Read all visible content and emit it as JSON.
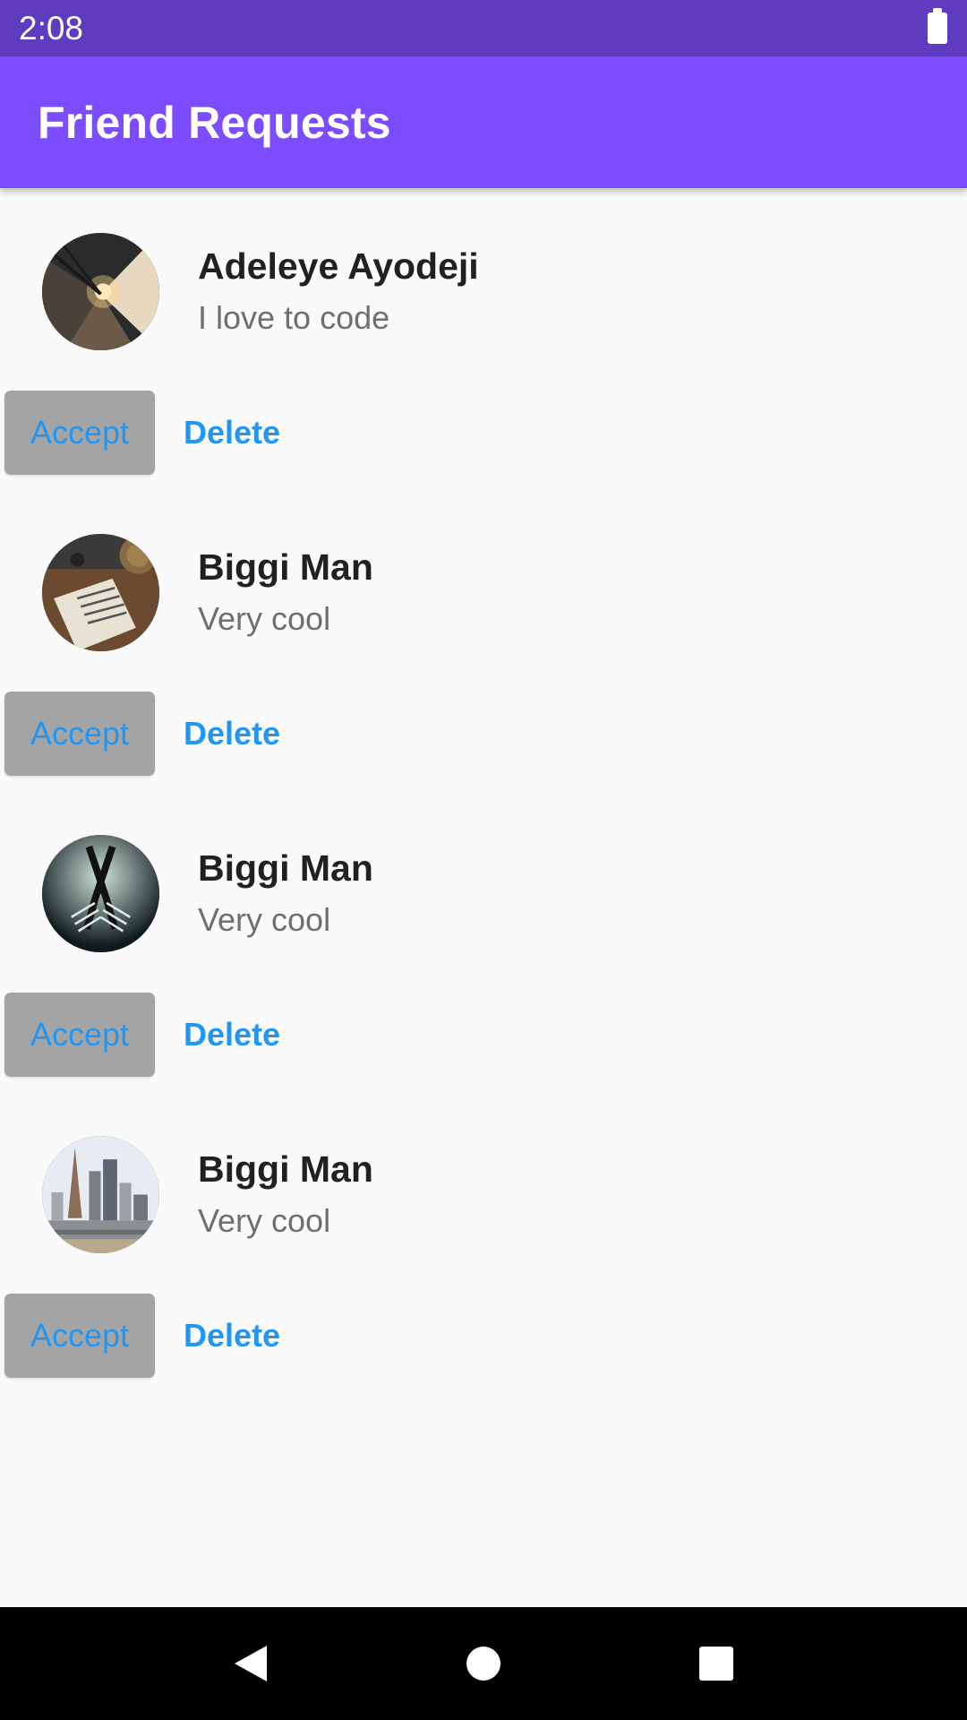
{
  "status_bar": {
    "time": "2:08"
  },
  "app_bar": {
    "title": "Friend Requests"
  },
  "requests": [
    {
      "name": "Adeleye Ayodeji",
      "bio": "I love to code",
      "accept_label": "Accept",
      "delete_label": "Delete",
      "avatar": "railway-bridge-photo"
    },
    {
      "name": "Biggi Man",
      "bio": "Very cool",
      "accept_label": "Accept",
      "delete_label": "Delete",
      "avatar": "desk-book-photo"
    },
    {
      "name": "Biggi Man",
      "bio": "Very cool",
      "accept_label": "Accept",
      "delete_label": "Delete",
      "avatar": "forks-photo"
    },
    {
      "name": "Biggi Man",
      "bio": "Very cool",
      "accept_label": "Accept",
      "delete_label": "Delete",
      "avatar": "city-skyline-photo"
    }
  ],
  "nav_bar": {
    "icons": [
      "back-icon",
      "home-icon",
      "recents-icon"
    ]
  },
  "colors": {
    "status_bar": "#5e3bbf",
    "app_bar": "#7c4dff",
    "accent": "#2196f3",
    "accept_bg": "#a4a4a4",
    "background": "#fafafa"
  }
}
